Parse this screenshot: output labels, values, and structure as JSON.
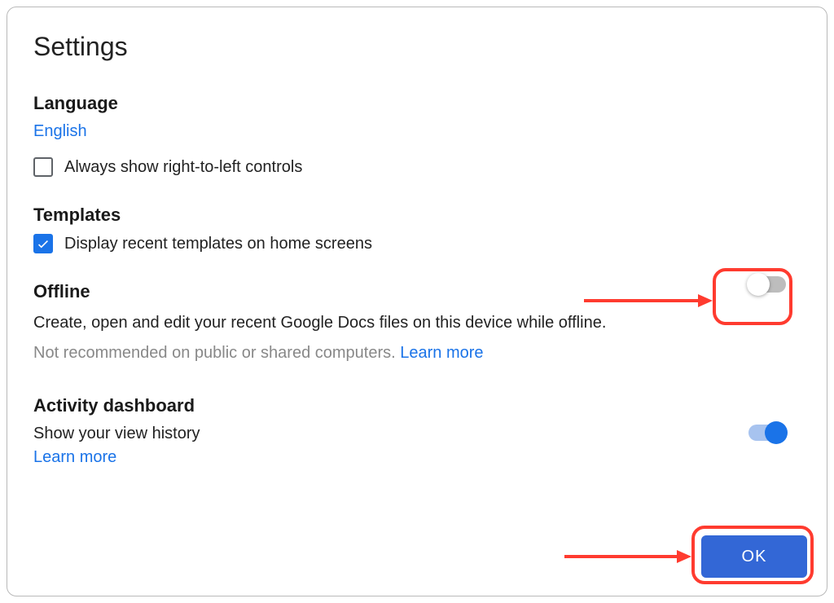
{
  "title": "Settings",
  "language": {
    "header": "Language",
    "value": "English",
    "rtl_checkbox_label": "Always show right-to-left controls",
    "rtl_checked": false
  },
  "templates": {
    "header": "Templates",
    "display_recent_label": "Display recent templates on home screens",
    "display_recent_checked": true
  },
  "offline": {
    "header": "Offline",
    "description": "Create, open and edit your recent Google Docs files on this device while offline.",
    "warning": "Not recommended on public or shared computers. ",
    "learn_more": "Learn more",
    "toggle_on": false
  },
  "activity": {
    "header": "Activity dashboard",
    "description": "Show your view history",
    "learn_more": "Learn more",
    "toggle_on": true
  },
  "ok_button": "OK"
}
